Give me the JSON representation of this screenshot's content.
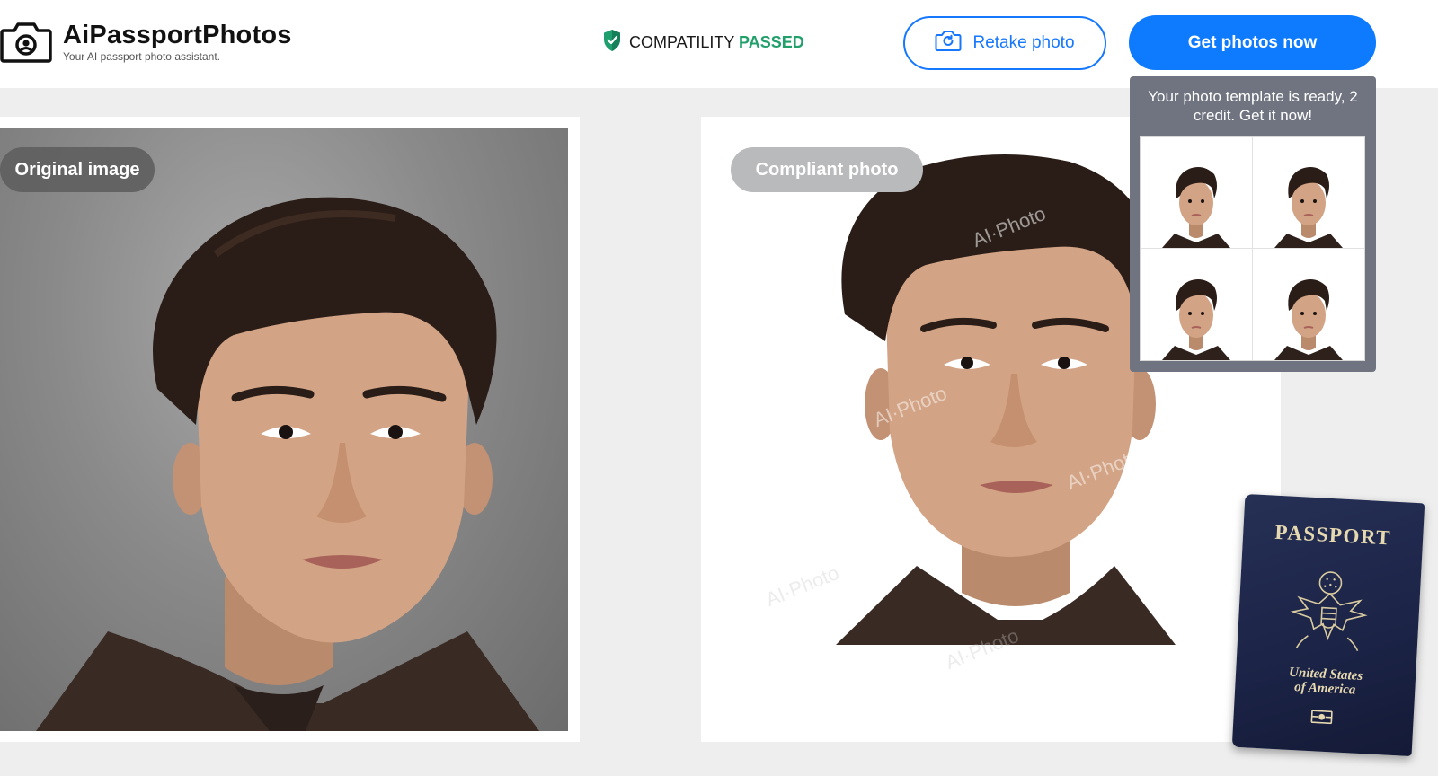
{
  "header": {
    "logo_name": "AiPassportPhotos",
    "logo_tagline": "Your AI passport photo assistant.",
    "compat_prefix": "COMPATILITY",
    "compat_status": "PASSED",
    "retake_label": "Retake photo",
    "get_photos_label": "Get photos now"
  },
  "main": {
    "original_label": "Original image",
    "compliant_label": "Compliant photo",
    "watermark_text": "AI·Photo"
  },
  "popup": {
    "message": "Your photo template is ready, 2 credit. Get it now!"
  },
  "passport": {
    "title": "PASSPORT",
    "country_line1": "United States",
    "country_line2": "of America"
  },
  "colors": {
    "accent": "#0e7bff",
    "passed": "#22a06b",
    "popup_bg": "#6f7480",
    "passport": "#1b2346"
  }
}
